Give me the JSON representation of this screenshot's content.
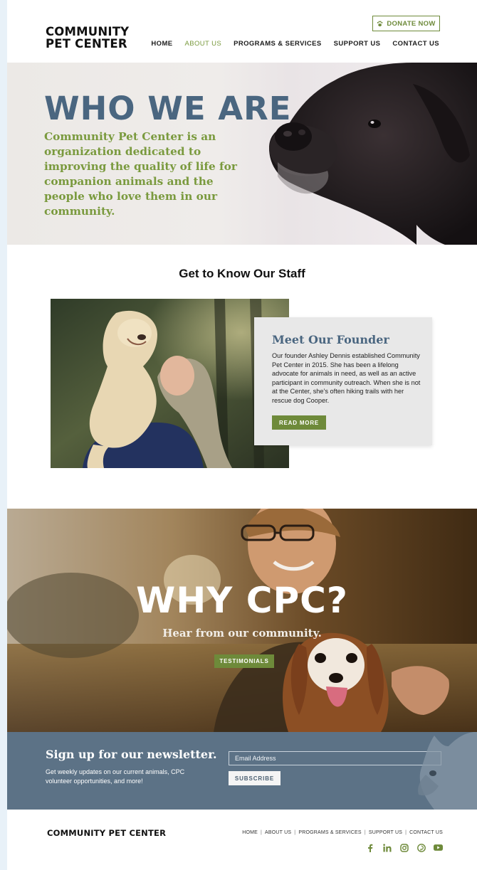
{
  "header": {
    "logo_line1": "COMMUNITY",
    "logo_line2": "PET CENTER",
    "donate_label": "DONATE NOW",
    "nav": [
      "HOME",
      "ABOUT US",
      "PROGRAMS & SERVICES",
      "SUPPORT US",
      "CONTACT US"
    ],
    "active_nav": "ABOUT US"
  },
  "hero": {
    "title": "WHO WE ARE",
    "text": "Community Pet Center is an organization dedicated to improving the quality of life for companion animals and the people who love them in our community."
  },
  "staff": {
    "section_title": "Get to Know Our Staff",
    "card_title": "Meet Our Founder",
    "card_text": "Our founder Ashley Dennis established Community Pet Center in 2015. She has been a lifelong advocate for animals in need, as well as an active participant in community outreach. When she is not at the Center, she’s often hiking trails with her rescue dog Cooper.",
    "button_label": "READ MORE"
  },
  "why": {
    "title": "WHY CPC?",
    "subtitle": "Hear from our community.",
    "button_label": "TESTIMONIALS"
  },
  "newsletter": {
    "title": "Sign up for our newsletter.",
    "text": "Get weekly updates on our current animals, CPC volunteer opportunities, and more!",
    "email_placeholder": "Email Address",
    "subscribe_label": "SUBSCRIBE"
  },
  "footer": {
    "logo": "COMMUNITY PET CENTER",
    "nav": [
      "HOME",
      "ABOUT US",
      "PROGRAMS & SERVICES",
      "SUPPORT US",
      "CONTACT US"
    ],
    "social_icons": [
      "facebook-icon",
      "linkedin-icon",
      "instagram-icon",
      "pinterest-icon",
      "youtube-icon"
    ]
  },
  "colors": {
    "accent_green": "#6e8a3a",
    "heading_blue": "#4a6680",
    "newsletter_bg": "#5c7286"
  }
}
